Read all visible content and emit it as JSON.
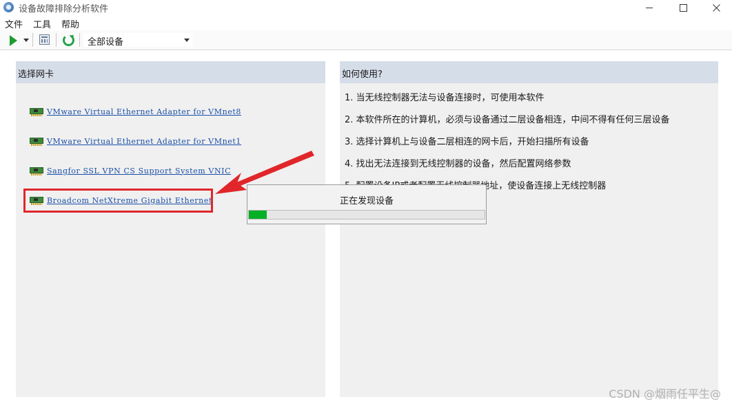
{
  "window": {
    "title": "设备故障排除分析软件"
  },
  "menu": [
    {
      "label": "文件"
    },
    {
      "label": "工具"
    },
    {
      "label": "帮助"
    }
  ],
  "toolbar": {
    "device_filter": "全部设备"
  },
  "left_panel": {
    "header": "选择网卡",
    "adapters": [
      {
        "label": "VMware Virtual Ethernet Adapter for VMnet8"
      },
      {
        "label": "VMware Virtual Ethernet Adapter for VMnet1"
      },
      {
        "label": "Sangfor SSL VPN CS Support System VNIC"
      },
      {
        "label": "Broadcom NetXtreme Gigabit Ethernet"
      }
    ]
  },
  "right_panel": {
    "header": "如何使用?",
    "steps": [
      "1. 当无线控制器无法与设备连接时，可使用本软件",
      "2. 本软件所在的计算机，必须与设备通过二层设备相连，中间不得有任何三层设备",
      "3. 选择计算机上与设备二层相连的网卡后，开始扫描所有设备",
      "4. 找出无法连接到无线控制器的设备，然后配置网络参数",
      "5. 配置设备IP或者配置无线控制器地址，使设备连接上无线控制器"
    ]
  },
  "progress_dialog": {
    "message": "正在发现设备",
    "progress": 0.075
  },
  "colors": {
    "progress_fill": "#06b025",
    "highlight": "#e0262a",
    "link": "#1a4fa8",
    "panel_header": "#d5dde9"
  },
  "watermark": "CSDN @烟雨任平生@"
}
